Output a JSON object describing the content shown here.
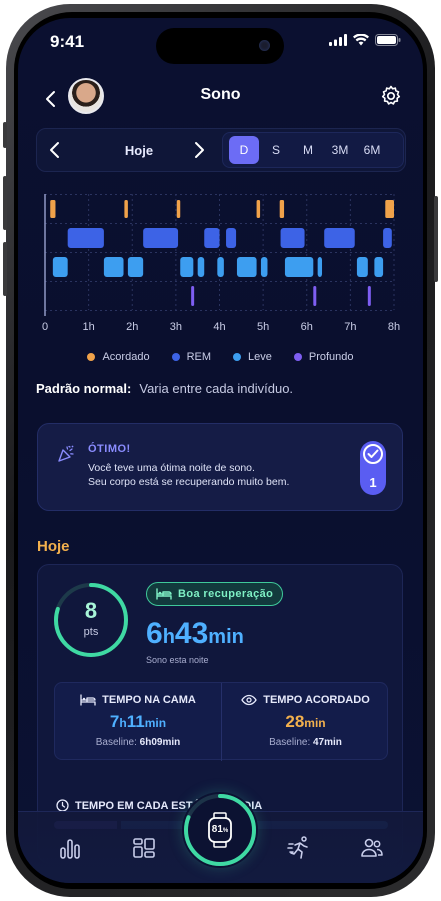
{
  "status_bar": {
    "time": "9:41"
  },
  "header": {
    "title": "Sono"
  },
  "period": {
    "label": "Hoje",
    "segments": [
      "D",
      "S",
      "M",
      "3M",
      "6M"
    ],
    "active": "D"
  },
  "chart_data": {
    "type": "timeline",
    "x_ticks": [
      "0",
      "1h",
      "2h",
      "3h",
      "4h",
      "5h",
      "6h",
      "7h",
      "8h"
    ],
    "x_range_hours": [
      0,
      8
    ],
    "stages": [
      "Acordado",
      "REM",
      "Leve",
      "Profundo"
    ],
    "colors": {
      "Acordado": "#f0a24a",
      "REM": "#3d63e6",
      "Leve": "#3d9ef0",
      "Profundo": "#7e5ef2"
    },
    "segments": [
      {
        "stage": "Acordado",
        "start": 0.12,
        "end": 0.24
      },
      {
        "stage": "Acordado",
        "start": 1.82,
        "end": 1.9
      },
      {
        "stage": "Acordado",
        "start": 3.02,
        "end": 3.1
      },
      {
        "stage": "Acordado",
        "start": 4.85,
        "end": 4.93
      },
      {
        "stage": "Acordado",
        "start": 5.38,
        "end": 5.48
      },
      {
        "stage": "Acordado",
        "start": 7.8,
        "end": 8.0
      },
      {
        "stage": "REM",
        "start": 0.52,
        "end": 1.35
      },
      {
        "stage": "REM",
        "start": 2.25,
        "end": 3.05
      },
      {
        "stage": "REM",
        "start": 3.65,
        "end": 4.0
      },
      {
        "stage": "REM",
        "start": 4.15,
        "end": 4.38
      },
      {
        "stage": "REM",
        "start": 5.4,
        "end": 5.95
      },
      {
        "stage": "REM",
        "start": 6.4,
        "end": 7.1
      },
      {
        "stage": "REM",
        "start": 7.75,
        "end": 7.95
      },
      {
        "stage": "Leve",
        "start": 0.18,
        "end": 0.52
      },
      {
        "stage": "Leve",
        "start": 1.35,
        "end": 1.8
      },
      {
        "stage": "Leve",
        "start": 1.9,
        "end": 2.25
      },
      {
        "stage": "Leve",
        "start": 3.1,
        "end": 3.4
      },
      {
        "stage": "Leve",
        "start": 3.5,
        "end": 3.65
      },
      {
        "stage": "Leve",
        "start": 3.95,
        "end": 4.1
      },
      {
        "stage": "Leve",
        "start": 4.4,
        "end": 4.85
      },
      {
        "stage": "Leve",
        "start": 4.95,
        "end": 5.1
      },
      {
        "stage": "Leve",
        "start": 5.5,
        "end": 6.15
      },
      {
        "stage": "Leve",
        "start": 6.25,
        "end": 6.35
      },
      {
        "stage": "Leve",
        "start": 7.15,
        "end": 7.4
      },
      {
        "stage": "Leve",
        "start": 7.55,
        "end": 7.75
      },
      {
        "stage": "Profundo",
        "start": 3.35,
        "end": 3.43
      },
      {
        "stage": "Profundo",
        "start": 6.15,
        "end": 6.23
      },
      {
        "stage": "Profundo",
        "start": 7.4,
        "end": 7.48
      }
    ],
    "xlabel": "",
    "ylabel": ""
  },
  "legend": [
    "Acordado",
    "REM",
    "Leve",
    "Profundo"
  ],
  "pattern": {
    "label": "Padrão normal:",
    "text": "Varia entre cada indivíduo."
  },
  "great_card": {
    "title": "ÓTIMO!",
    "line1": "Você teve uma ótima noite de sono.",
    "line2": "Seu corpo está se recuperando muito bem.",
    "count": "1"
  },
  "today": {
    "label": "Hoje",
    "score": "8",
    "score_unit": "pts",
    "score_fraction": 0.8,
    "recovery_badge": "Boa recuperação",
    "sleep_hours": "6",
    "sleep_h_unit": "h",
    "sleep_minutes": "43",
    "sleep_min_unit": "min",
    "sleep_caption": "Sono esta noite",
    "bed": {
      "title": "TEMPO NA CAMA",
      "hours": "7",
      "h_unit": "h",
      "minutes": "11",
      "min_unit": "min",
      "baseline_label": "Baseline:",
      "baseline_value": "6h09min"
    },
    "awake": {
      "title": "TEMPO ACORDADO",
      "minutes": "28",
      "min_unit": "min",
      "baseline_label": "Baseline:",
      "baseline_value": "47min"
    },
    "stage_title": "TEMPO EM CADA ESTÁGIO NO DIA"
  },
  "nav": {
    "watch_battery": "81",
    "watch_battery_unit": "%",
    "watch_battery_fraction": 0.81
  },
  "colors": {
    "accent": "#6c6cf5",
    "orange": "#f3b04d",
    "green": "#3fd9a3",
    "blue": "#4fb0ff",
    "background": "#0b1030"
  }
}
